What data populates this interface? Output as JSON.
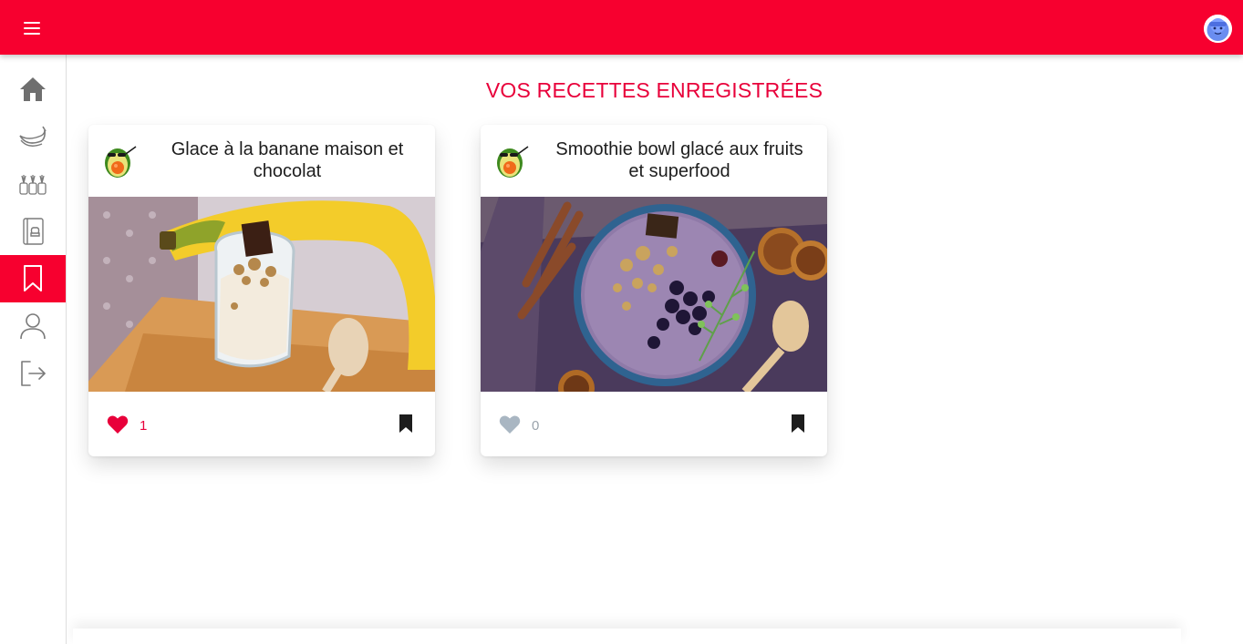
{
  "header": {
    "menu_icon": "hamburger-menu-icon",
    "avatar_icon": "user-avatar-icon"
  },
  "sidebar": {
    "items": [
      {
        "icon": "home-icon",
        "active": false
      },
      {
        "icon": "banana-icon",
        "active": false
      },
      {
        "icon": "recipes-grid-icon",
        "active": false
      },
      {
        "icon": "recipe-book-icon",
        "active": false
      },
      {
        "icon": "bookmark-icon",
        "active": true
      },
      {
        "icon": "user-profile-icon",
        "active": false
      },
      {
        "icon": "logout-icon",
        "active": false
      }
    ]
  },
  "page": {
    "title": "VOS RECETTES ENREGISTRÉES"
  },
  "recipes": [
    {
      "title": "Glace à la banane maison et chocolat",
      "likes": "1",
      "liked": true,
      "saved": true
    },
    {
      "title": "Smoothie bowl glacé aux fruits et superfood",
      "likes": "0",
      "liked": false,
      "saved": true
    }
  ],
  "colors": {
    "brand": "#f7002f",
    "title": "#e8003a",
    "liked": "#e8003a",
    "unliked": "#a9b6c2",
    "count_liked": "#e8003a",
    "count_unliked": "#9aa3ab"
  }
}
